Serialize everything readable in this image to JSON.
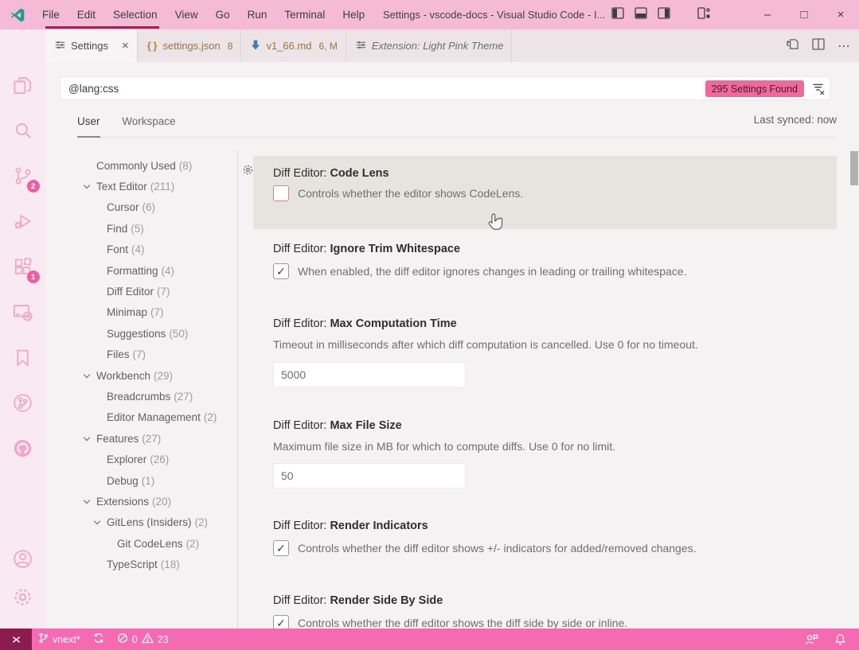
{
  "titlebar": {
    "menus": [
      "File",
      "Edit",
      "Selection",
      "View",
      "Go",
      "Run",
      "Terminal",
      "Help"
    ],
    "title": "Settings - vscode-docs - Visual Studio Code - I...",
    "window_controls": {
      "minimize": "–",
      "maximize": "□",
      "close": "×"
    }
  },
  "tabs": [
    {
      "label": "Settings",
      "icon": "settings-tune-icon",
      "active": true,
      "closable": true,
      "close_glyph": "×"
    },
    {
      "label": "settings.json",
      "icon": "json-braces-icon",
      "suffix": "8",
      "gold": true
    },
    {
      "label": "v1_66.md",
      "icon": "markdown-download-icon",
      "suffix": "6, M",
      "gold": true
    },
    {
      "label": "Extension: Light Pink Theme",
      "icon": "settings-tune-icon",
      "italic": true
    }
  ],
  "editor_actions": {
    "open_changes": "open-changes-icon",
    "split": "split-editor-icon",
    "more": "⋯"
  },
  "search": {
    "value": "@lang:css",
    "results_badge": "295 Settings Found",
    "clear_filter_icon": "clear-filters-icon"
  },
  "scope": {
    "user": "User",
    "workspace": "Workspace",
    "synced": "Last synced: now"
  },
  "toc": [
    {
      "label": "Commonly Used",
      "count": "(8)",
      "level": 0,
      "chevron": false
    },
    {
      "label": "Text Editor",
      "count": "(211)",
      "level": 0,
      "chevron": true
    },
    {
      "label": "Cursor",
      "count": "(6)",
      "level": 1,
      "chevron": false
    },
    {
      "label": "Find",
      "count": "(5)",
      "level": 1,
      "chevron": false
    },
    {
      "label": "Font",
      "count": "(4)",
      "level": 1,
      "chevron": false
    },
    {
      "label": "Formatting",
      "count": "(4)",
      "level": 1,
      "chevron": false
    },
    {
      "label": "Diff Editor",
      "count": "(7)",
      "level": 1,
      "chevron": false
    },
    {
      "label": "Minimap",
      "count": "(7)",
      "level": 1,
      "chevron": false
    },
    {
      "label": "Suggestions",
      "count": "(50)",
      "level": 1,
      "chevron": false
    },
    {
      "label": "Files",
      "count": "(7)",
      "level": 1,
      "chevron": false
    },
    {
      "label": "Workbench",
      "count": "(29)",
      "level": 0,
      "chevron": true
    },
    {
      "label": "Breadcrumbs",
      "count": "(27)",
      "level": 1,
      "chevron": false
    },
    {
      "label": "Editor Management",
      "count": "(2)",
      "level": 1,
      "chevron": false
    },
    {
      "label": "Features",
      "count": "(27)",
      "level": 0,
      "chevron": true
    },
    {
      "label": "Explorer",
      "count": "(26)",
      "level": 1,
      "chevron": false
    },
    {
      "label": "Debug",
      "count": "(1)",
      "level": 1,
      "chevron": false
    },
    {
      "label": "Extensions",
      "count": "(20)",
      "level": 0,
      "chevron": true
    },
    {
      "label": "GitLens (Insiders)",
      "count": "(2)",
      "level": 1,
      "chevron": true
    },
    {
      "label": "Git CodeLens",
      "count": "(2)",
      "level": 2,
      "chevron": false
    },
    {
      "label": "TypeScript",
      "count": "(18)",
      "level": 1,
      "chevron": false
    }
  ],
  "settings": [
    {
      "category": "Diff Editor: ",
      "name": "Code Lens",
      "type": "checkbox",
      "checked": false,
      "hovered": true,
      "desc": "Controls whether the editor shows CodeLens."
    },
    {
      "category": "Diff Editor: ",
      "name": "Ignore Trim Whitespace",
      "type": "checkbox",
      "checked": true,
      "desc": "When enabled, the diff editor ignores changes in leading or trailing whitespace."
    },
    {
      "category": "Diff Editor: ",
      "name": "Max Computation Time",
      "type": "input",
      "value": "5000",
      "desc": "Timeout in milliseconds after which diff computation is cancelled. Use 0 for no timeout."
    },
    {
      "category": "Diff Editor: ",
      "name": "Max File Size",
      "type": "input",
      "value": "50",
      "desc": "Maximum file size in MB for which to compute diffs. Use 0 for no limit."
    },
    {
      "category": "Diff Editor: ",
      "name": "Render Indicators",
      "type": "checkbox",
      "checked": true,
      "desc": "Controls whether the diff editor shows +/- indicators for added/removed changes."
    },
    {
      "category": "Diff Editor: ",
      "name": "Render Side By Side",
      "type": "checkbox",
      "checked": true,
      "desc": "Controls whether the diff editor shows the diff side by side or inline."
    }
  ],
  "activity_bar": {
    "items": [
      {
        "icon": "explorer-icon"
      },
      {
        "icon": "search-icon"
      },
      {
        "icon": "source-control-icon",
        "badge": "2"
      },
      {
        "icon": "run-debug-icon"
      },
      {
        "icon": "extensions-icon",
        "badge": "1"
      },
      {
        "icon": "remote-explorer-icon"
      },
      {
        "icon": "bookmarks-icon"
      },
      {
        "icon": "gitlens-icon"
      },
      {
        "icon": "github-icon"
      }
    ],
    "bottom": [
      {
        "icon": "accounts-icon"
      },
      {
        "icon": "manage-gear-icon"
      }
    ]
  },
  "status_bar": {
    "remote_icon": "remote-indicator-icon",
    "branch": "vnext*",
    "errors": "0",
    "warnings": "23"
  },
  "colors": {
    "titlebar_bg": "#f5bbd6",
    "statusbar_bg": "#f56bb1",
    "remote_bg": "#8c1c50",
    "activity_bg": "#f9e9f1",
    "activity_icon": "#f1a6c9",
    "badge_bg": "#ed5fa3",
    "search_badge_bg": "#f0699d",
    "active_tab_border": "#bf1050",
    "editor_bg": "#f5f2f3",
    "tabbar_bg": "#ece4e6",
    "hover_row_bg": "#e7e4e0"
  }
}
